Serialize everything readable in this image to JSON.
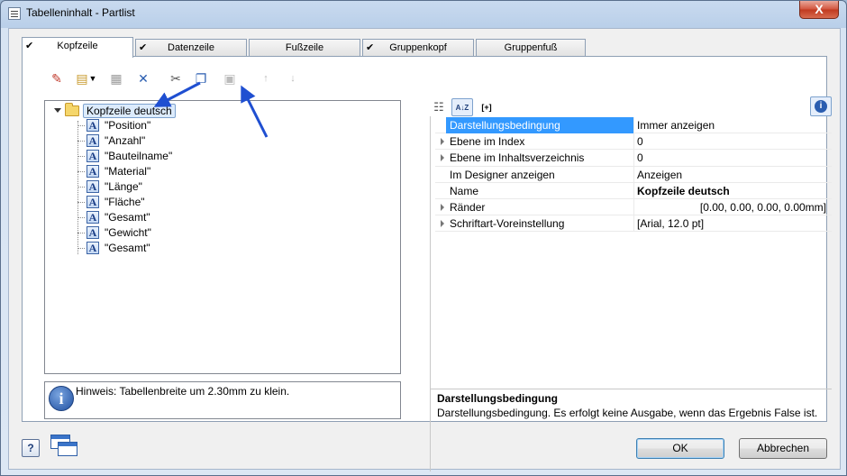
{
  "window": {
    "title": "Tabelleninhalt - Partlist",
    "close_label": "X"
  },
  "tabs": [
    {
      "label": "Kopfzeile",
      "checked": true,
      "active": true
    },
    {
      "label": "Datenzeile",
      "checked": true,
      "active": false
    },
    {
      "label": "Fußzeile",
      "checked": false,
      "active": false
    },
    {
      "label": "Gruppenkopf",
      "checked": true,
      "active": false
    },
    {
      "label": "Gruppenfuß",
      "checked": false,
      "active": false
    }
  ],
  "tab_check_glyph": "✔",
  "toolbar_left": {
    "icons": [
      "edit-wand-icon",
      "new-item-icon",
      "dropdown-arrow-icon",
      "insert-icon",
      "delete-icon",
      "cut-icon",
      "copy-icon",
      "paste-icon",
      "move-up-icon",
      "move-down-icon"
    ]
  },
  "tree": {
    "root_label": "Kopfzeile deutsch",
    "items": [
      "\"Position\"",
      "\"Anzahl\"",
      "\"Bauteilname\"",
      "\"Material\"",
      "\"Länge\"",
      "\"Fläche\"",
      "\"Gesamt\"",
      "\"Gewicht\"",
      "\"Gesamt\""
    ],
    "item_icon_letter": "A"
  },
  "hint": {
    "icon_letter": "i",
    "text": "Hinweis: Tabellenbreite um 2.30mm zu klein."
  },
  "right_toolbar": {
    "sort_label": "A↓Z",
    "expand_label": "[+]"
  },
  "properties": [
    {
      "name": "Darstellungsbedingung",
      "value": "Immer anzeigen",
      "expandable": false,
      "selected": true
    },
    {
      "name": "Ebene im Index",
      "value": "0",
      "expandable": true,
      "selected": false
    },
    {
      "name": "Ebene im Inhaltsverzeichnis",
      "value": "0",
      "expandable": true,
      "selected": false
    },
    {
      "name": "Im Designer anzeigen",
      "value": "Anzeigen",
      "expandable": false,
      "selected": false
    },
    {
      "name": "Name",
      "value": "Kopfzeile deutsch",
      "expandable": false,
      "selected": false,
      "bold": true
    },
    {
      "name": "Ränder",
      "value": "[0.00, 0.00, 0.00, 0.00mm]",
      "expandable": true,
      "selected": false,
      "align_right": true
    },
    {
      "name": "Schriftart-Voreinstellung",
      "value": "[Arial, 12.0 pt]",
      "expandable": true,
      "selected": false
    }
  ],
  "description": {
    "title": "Darstellungsbedingung",
    "text": "Darstellungsbedingung. Es erfolgt keine Ausgabe, wenn das Ergebnis False ist."
  },
  "footer": {
    "help_label": "?",
    "ok_label": "OK",
    "cancel_label": "Abbrechen"
  },
  "colors": {
    "selection": "#3399ff",
    "annotation_arrow": "#1f4fd1"
  }
}
